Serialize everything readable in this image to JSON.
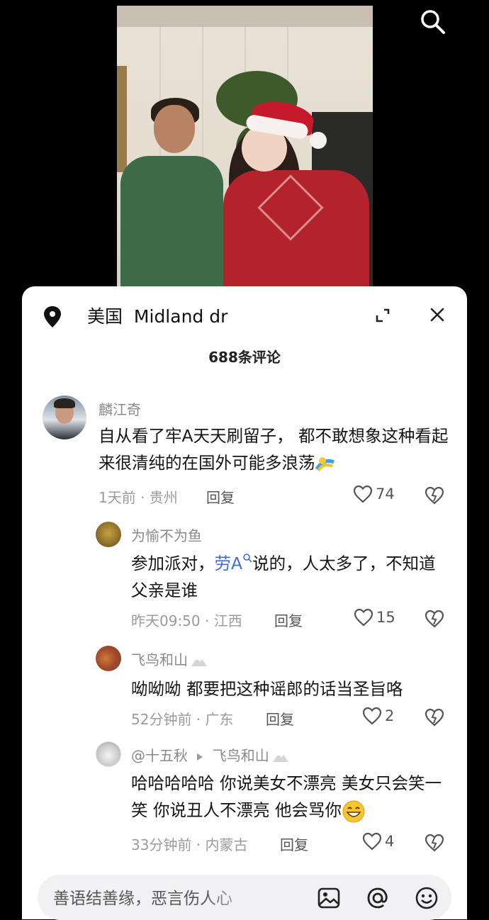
{
  "location": {
    "country": "美国",
    "place": "Midland dr"
  },
  "comment_count": "688条评论",
  "comments": [
    {
      "name": "麟江奇",
      "text": "自从看了牢A天天刷留子， 都不敢想象这种看起来很清纯的在国外可能多浪荡",
      "time_loc": "1天前 · 贵州",
      "reply": "回复",
      "likes": "74"
    },
    {
      "name": "为愉不为鱼",
      "text_before": "参加派对，",
      "mention": "劳A",
      "text_after": "说的，人太多了，不知道父亲是谁",
      "time_loc": "昨天09:50 · 江西",
      "reply": "回复",
      "likes": "15"
    },
    {
      "name": "飞鸟和山",
      "text": "呦呦呦 都要把这种谣郎的话当圣旨咯",
      "time_loc": "52分钟前 · 广东",
      "reply": "回复",
      "likes": "2"
    },
    {
      "name": "@十五秋",
      "reply_to": "飞鸟和山",
      "text": "哈哈哈哈哈 你说美女不漂亮 美女只会笑一笑 你说丑人不漂亮 他会骂你",
      "time_loc": "33分钟前 · 内蒙古",
      "reply": "回复",
      "likes": "4"
    }
  ],
  "input": {
    "placeholder": "善语结善缘，恶言伤人心"
  },
  "icons": [
    "search-icon",
    "location-pin-icon",
    "expand-icon",
    "close-icon",
    "heart-icon",
    "dislike-heart-icon",
    "image-icon",
    "at-icon",
    "emoji-icon"
  ]
}
